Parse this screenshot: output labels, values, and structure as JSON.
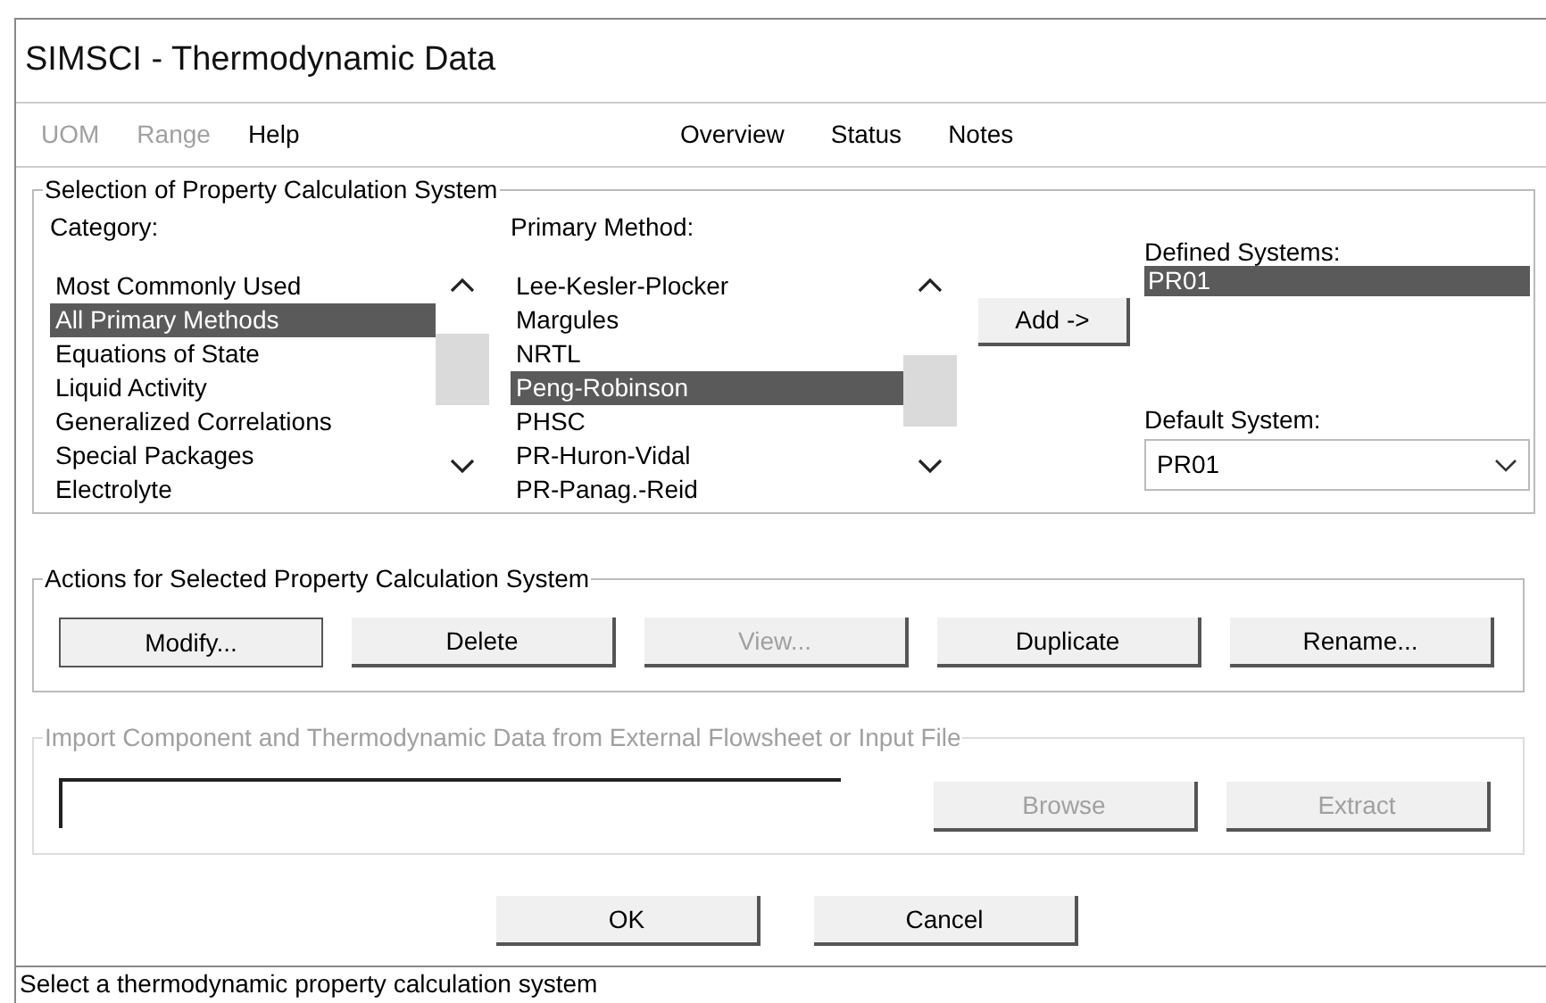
{
  "window": {
    "title": "SIMSCI - Thermodynamic Data"
  },
  "menu_left": [
    {
      "label": "UOM",
      "disabled": true
    },
    {
      "label": "Range",
      "disabled": true
    },
    {
      "label": "Help",
      "disabled": false
    }
  ],
  "menu_right": [
    {
      "label": "Overview",
      "disabled": false
    },
    {
      "label": "Status",
      "disabled": false
    },
    {
      "label": "Notes",
      "disabled": false
    }
  ],
  "selection_group": {
    "title": "Selection of Property Calculation System",
    "category": {
      "label": "Category:",
      "items": [
        {
          "label": "Most Commonly Used",
          "selected": false
        },
        {
          "label": "All Primary Methods",
          "selected": true
        },
        {
          "label": "Equations of State",
          "selected": false
        },
        {
          "label": "Liquid Activity",
          "selected": false
        },
        {
          "label": "Generalized Correlations",
          "selected": false
        },
        {
          "label": "Special Packages",
          "selected": false
        },
        {
          "label": "Electrolyte",
          "selected": false
        }
      ]
    },
    "primary_method": {
      "label": "Primary Method:",
      "items": [
        {
          "label": "Lee-Kesler-Plocker",
          "selected": false
        },
        {
          "label": "Margules",
          "selected": false
        },
        {
          "label": "NRTL",
          "selected": false
        },
        {
          "label": "Peng-Robinson",
          "selected": true
        },
        {
          "label": "PHSC",
          "selected": false
        },
        {
          "label": "PR-Huron-Vidal",
          "selected": false
        },
        {
          "label": "PR-Panag.-Reid",
          "selected": false
        }
      ]
    },
    "add_button": "Add ->",
    "defined_systems": {
      "label": "Defined Systems:",
      "items": [
        {
          "label": "PR01",
          "selected": true
        }
      ]
    },
    "default_system": {
      "label": "Default System:",
      "value": "PR01"
    }
  },
  "actions_group": {
    "title": "Actions for Selected Property Calculation System",
    "buttons": [
      {
        "label": "Modify...",
        "disabled": false,
        "default": true
      },
      {
        "label": "Delete",
        "disabled": false,
        "default": false
      },
      {
        "label": "View...",
        "disabled": true,
        "default": false
      },
      {
        "label": "Duplicate",
        "disabled": false,
        "default": false
      },
      {
        "label": "Rename...",
        "disabled": false,
        "default": false
      }
    ]
  },
  "import_group": {
    "title": "Import Component and Thermodynamic Data from External Flowsheet or Input File",
    "disabled": true,
    "buttons": [
      {
        "label": "Browse",
        "disabled": true,
        "default": false
      },
      {
        "label": "Extract",
        "disabled": true,
        "default": false
      }
    ]
  },
  "dialog_buttons": [
    {
      "label": "OK",
      "disabled": false,
      "default": false
    },
    {
      "label": "Cancel",
      "disabled": false,
      "default": false
    }
  ],
  "status_bar": "Select a thermodynamic property calculation system"
}
